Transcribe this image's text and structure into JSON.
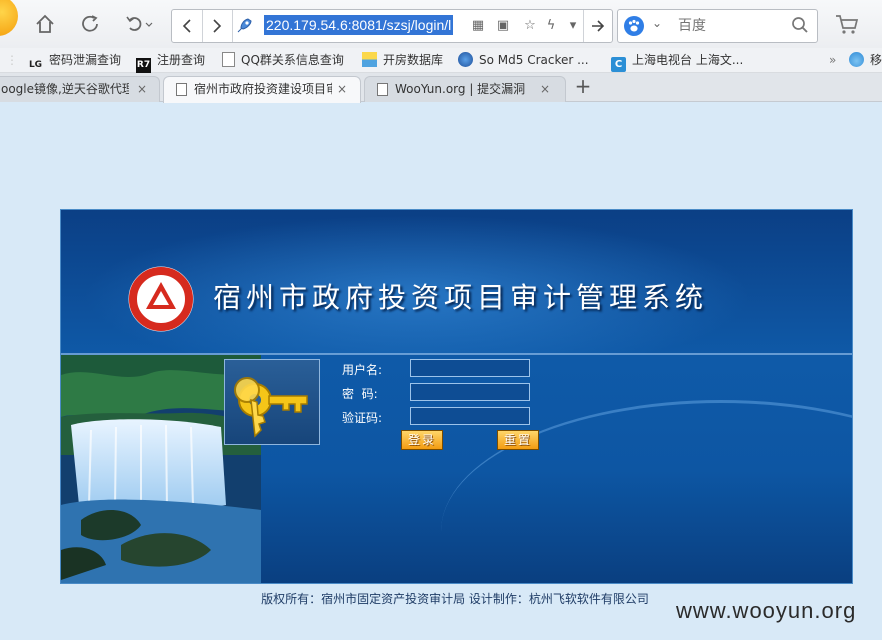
{
  "browser": {
    "address_url": "220.179.54.6:8081/szsj/login/l",
    "search_engine_label": "百度",
    "bookmarks": [
      {
        "icon": "LG",
        "label": "密码泄漏查询"
      },
      {
        "icon": "R7",
        "label": "注册查询"
      },
      {
        "icon": "",
        "label": "QQ群关系信息查询"
      },
      {
        "icon": "",
        "label": "开房数据库"
      },
      {
        "icon": "",
        "label": "So Md5 Cracker ..."
      },
      {
        "icon": "C",
        "label": "上海电视台 上海文..."
      },
      {
        "icon": "",
        "label": "移"
      }
    ],
    "bookmarks_overflow": "»",
    "tabs": [
      {
        "title": "oogle镜像,逆天谷歌代理",
        "active": false
      },
      {
        "title": "宿州市政府投资建设项目审",
        "active": true
      },
      {
        "title": "WooYun.org | 提交漏洞",
        "active": false
      }
    ],
    "close_glyph": "×",
    "new_tab_glyph": "+"
  },
  "login": {
    "system_title": "宿州市政府投资项目审计管理系统",
    "username_label": "用户名:",
    "password_label": "密  码:",
    "captcha_label": "验证码:",
    "username_value": "",
    "password_value": "",
    "captcha_value": "",
    "login_button": "登录",
    "reset_button": "重置"
  },
  "footer": {
    "copyright": "版权所有：宿州市固定资产投资审计局  设计制作：杭州飞软软件有限公司"
  },
  "watermark": "www.wooyun.org",
  "colors": {
    "panel_blue": "#0f5aa8",
    "button_orange": "#f39c12",
    "page_background": "#d8e9f7"
  }
}
